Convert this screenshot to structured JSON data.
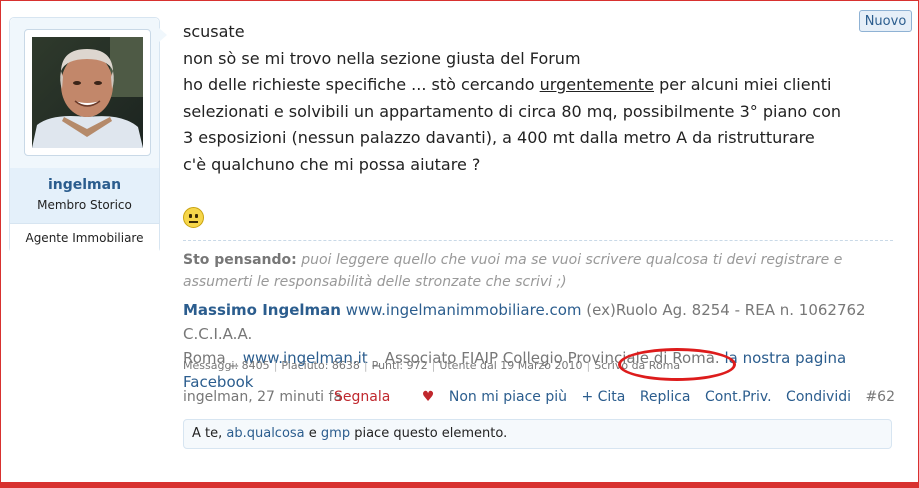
{
  "user": {
    "name": "ingelman",
    "title": "Membro Storico",
    "banner": "Agente Immobiliare"
  },
  "badge": "Nuovo",
  "message": {
    "lines": [
      "scusate",
      "non sò se mi trovo nella sezione giusta del Forum",
      "ho delle richieste specifiche ... stò cercando ",
      "urgentemente",
      " per alcuni miei clienti",
      "selezionati e solvibili un appartamento di circa 80 mq, possibilmente 3° piano con",
      "3 esposizioni (nessun palazzo davanti), a 400 mt dalla metro A da ristrutturare",
      "c'è qualchuno che mi possa aiutare ?"
    ]
  },
  "thinking": {
    "label": "Sto pensando:",
    "text": "puoi leggere quello che vuoi ma se vuoi scrivere qualcosa ti devi registrare e assumerti le responsabilità delle stronzate che scrivi ;)"
  },
  "signature": {
    "name": "Massimo Ingelman",
    "site1": "www.ingelmanimmobiliare.com",
    "text1": " (ex)Ruolo Ag. 8254 - REA n. 1062762 C.C.I.A.A.",
    "text2": "Roma _ ",
    "site2": "www.ingelman.it",
    "text3": " _ Associato FIAIP Collegio Provinciale di Roma. ",
    "fb": "la nostra pagina Facebook"
  },
  "stats": {
    "messages": "Messaggi: 8405",
    "likes": "Piaciuto: 8638",
    "points": "Punti: 972",
    "joined": "Utente dal 19 Marzo 2010",
    "location": "Scrivo da Roma"
  },
  "actions": {
    "poster": "ingelman",
    "time": ", 27 minuti fa",
    "report": "Segnala",
    "unlike": "Non mi piace più",
    "quote": "+ Cita",
    "reply": "Replica",
    "private": "Cont.Priv.",
    "share": "Condividi",
    "postnum": "#62"
  },
  "likes": {
    "prefix": "A te, ",
    "user1": "ab.qualcosa",
    "and": " e ",
    "user2": "gmp",
    "suffix": " piace questo elemento."
  },
  "colors": {
    "link": "#2b5d8e",
    "accent_red": "#dd1c1c",
    "card_bg": "#f0f7fc"
  }
}
